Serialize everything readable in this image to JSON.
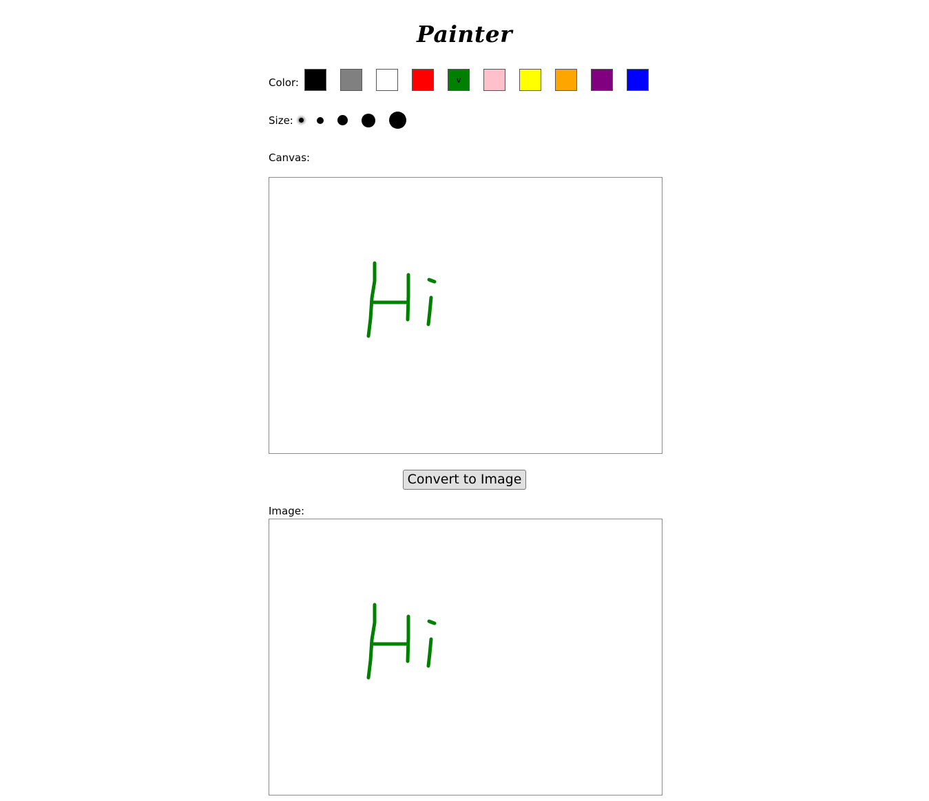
{
  "app": {
    "title": "Painter"
  },
  "color_picker": {
    "label": "Color:",
    "selected_marker": "v",
    "selected_index": 4,
    "swatches": [
      {
        "name": "black",
        "color": "#000000"
      },
      {
        "name": "gray",
        "color": "#808080"
      },
      {
        "name": "white",
        "color": "#ffffff"
      },
      {
        "name": "red",
        "color": "#ff0000"
      },
      {
        "name": "green",
        "color": "#008000"
      },
      {
        "name": "pink",
        "color": "#ffc0cb"
      },
      {
        "name": "yellow",
        "color": "#ffff00"
      },
      {
        "name": "orange",
        "color": "#ffa500"
      },
      {
        "name": "purple",
        "color": "#800080"
      },
      {
        "name": "blue",
        "color": "#0000ff"
      }
    ]
  },
  "size_picker": {
    "label": "Size:",
    "selected_index": 0,
    "sizes": [
      "extra-small",
      "small",
      "medium",
      "large",
      "extra-large"
    ]
  },
  "canvas": {
    "label": "Canvas:",
    "stroke_color": "#008000"
  },
  "convert_button": {
    "label": "Convert to Image"
  },
  "image_output": {
    "label": "Image:"
  }
}
